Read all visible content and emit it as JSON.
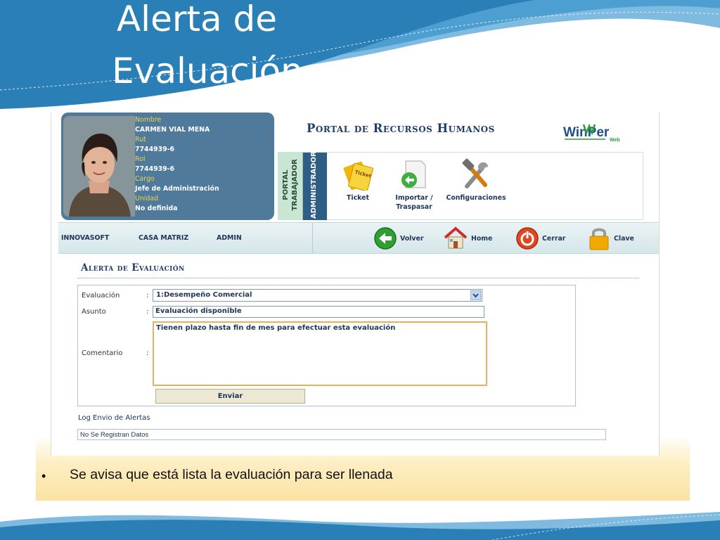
{
  "slide": {
    "title_line1": "Alerta de",
    "title_line2": "Evaluación",
    "bullet": "Se avisa que está lista la evaluación para ser llenada"
  },
  "profile": {
    "name_label": "Nombre",
    "name": "CARMEN VIAL MENA",
    "rut_label": "Rut",
    "rut": "7744939-6",
    "rol_label": "Rol",
    "rol": "7744939-6",
    "cargo_label": "Cargo",
    "cargo": "Jefe de Administración",
    "unidad_label": "Unidad",
    "unidad": "No definida"
  },
  "header": {
    "portal_title": "Portal de Recursos Humanos",
    "logo_text": "WinPer",
    "logo_sub": "Web"
  },
  "tabs": {
    "trabajador_line1": "PORTAL",
    "trabajador_line2": "TRABAJADOR",
    "admin": "ADMINISTRADOR"
  },
  "menu": {
    "ticket": "Ticket",
    "importar_line1": "Importar /",
    "importar_line2": "Traspasar",
    "config": "Configuraciones"
  },
  "nav": {
    "company": "INNOVASOFT",
    "branch": "CASA MATRIZ",
    "user": "ADMIN",
    "back": "Volver",
    "home": "Home",
    "close": "Cerrar",
    "key": "Clave"
  },
  "form": {
    "title": "Alerta de Evaluación",
    "eval_label": "Evaluación",
    "eval_value": "1:Desempeño Comercial",
    "subject_label": "Asunto",
    "subject_value": "Evaluación disponible",
    "comment_label": "Comentario",
    "comment_value": "Tienen plazo hasta fin de mes para efectuar esta evaluación",
    "colon": ":",
    "send": "Enviar"
  },
  "log": {
    "title": "Log Envio de Alertas",
    "empty": "No Se Registran Datos"
  },
  "colors": {
    "wave_dark": "#2a7fb6",
    "wave_light": "#7fbbe0",
    "accent_navy": "#1f3e66",
    "profile_bg": "#4f7a9b",
    "label_yellow": "#f0d44a"
  }
}
